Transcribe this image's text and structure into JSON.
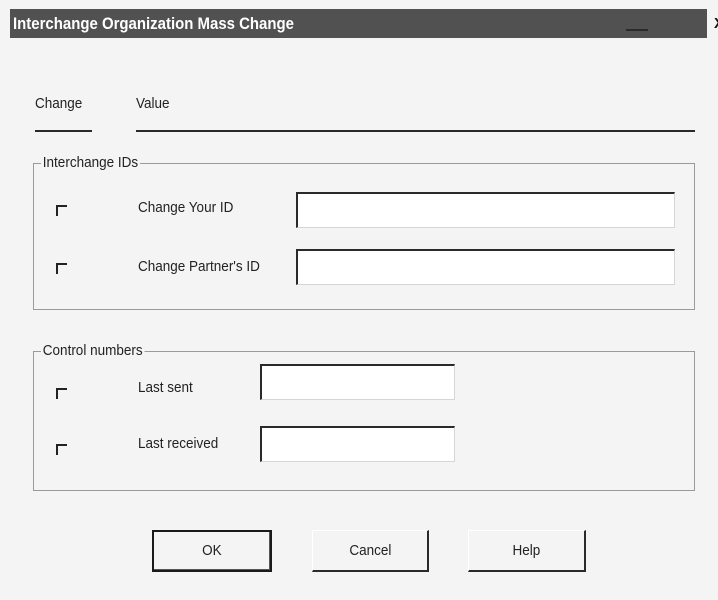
{
  "window": {
    "title": "Interchange Organization Mass Change",
    "close_glyph": "X"
  },
  "columns": {
    "change": "Change",
    "value": "Value"
  },
  "groups": {
    "interchange_ids": {
      "label": "Interchange IDs",
      "rows": [
        {
          "label": "Change Your ID",
          "value": "",
          "checked": false
        },
        {
          "label": "Change Partner's ID",
          "value": "",
          "checked": false
        }
      ]
    },
    "control_numbers": {
      "label": "Control numbers",
      "rows": [
        {
          "label": "Last sent",
          "value": "",
          "checked": false
        },
        {
          "label": "Last received",
          "value": "",
          "checked": false
        }
      ]
    }
  },
  "buttons": {
    "ok": "OK",
    "cancel": "Cancel",
    "help": "Help"
  },
  "colors": {
    "titlebar": "#515151",
    "dialog_bg": "#f4f4f4"
  }
}
